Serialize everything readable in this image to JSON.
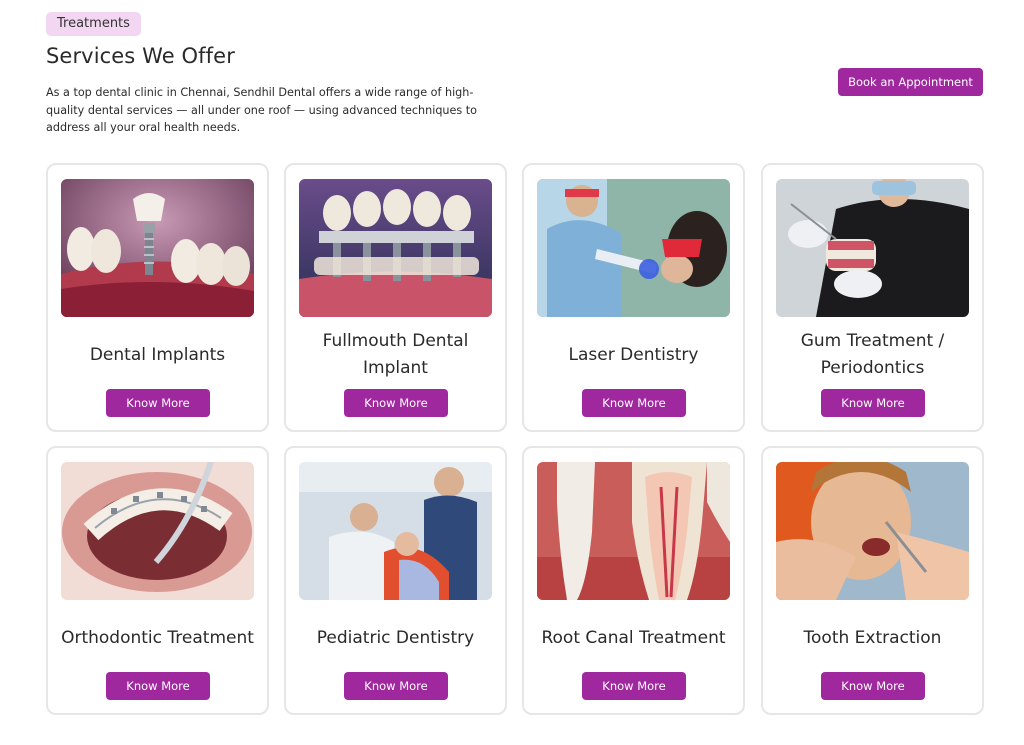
{
  "section": {
    "badge": "Treatments",
    "title": "Services We Offer",
    "intro": "As a top dental clinic in Chennai, Sendhil Dental offers a wide range of high-quality dental services — all under one roof — using advanced techniques to address all your oral health needs.",
    "cta_label": "Book an Appointment"
  },
  "services": [
    {
      "name": "Dental Implants",
      "button": "Know More",
      "image": "dental-implant-image"
    },
    {
      "name": "Fullmouth Dental Implant",
      "button": "Know More",
      "image": "fullmouth-implant-image"
    },
    {
      "name": "Laser Dentistry",
      "button": "Know More",
      "image": "laser-dentistry-image"
    },
    {
      "name": "Gum Treatment / Periodontics",
      "button": "Know More",
      "image": "gum-treatment-image"
    },
    {
      "name": "Orthodontic Treatment",
      "button": "Know More",
      "image": "orthodontic-image"
    },
    {
      "name": "Pediatric Dentistry",
      "button": "Know More",
      "image": "pediatric-dentistry-image"
    },
    {
      "name": "Root Canal Treatment",
      "button": "Know More",
      "image": "root-canal-image"
    },
    {
      "name": "Tooth Extraction",
      "button": "Know More",
      "image": "tooth-extraction-image"
    }
  ],
  "colors": {
    "accent": "#a0289f",
    "badge_bg": "#f3d6f1",
    "card_border": "#e6e6e6"
  }
}
